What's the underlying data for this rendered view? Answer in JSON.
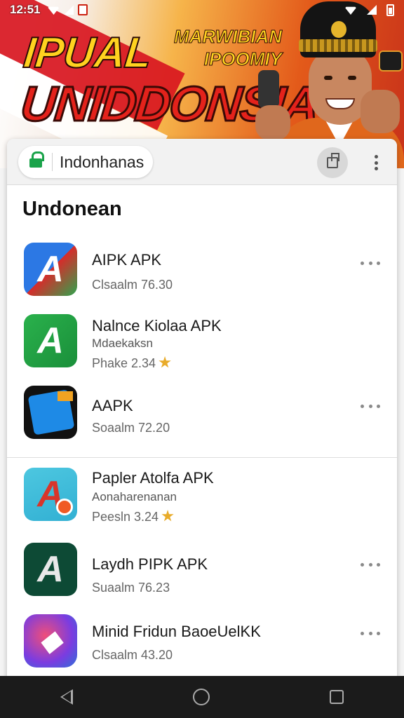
{
  "status_bar": {
    "time": "12:51"
  },
  "banner": {
    "headline_top": "IPUAL",
    "headline_small_1": "MARWIBIAN",
    "headline_small_2": "IPOOMIY",
    "headline_main": "UNIDDONSIA",
    "colors": {
      "yellow": "#ffd21f",
      "red": "#e4221b",
      "orange": "#e0671c"
    }
  },
  "browser": {
    "url_text": "Indonhanas",
    "lock_icon": "lock-icon",
    "tabs_icon": "tabs-icon",
    "menu_icon": "kebab-menu-icon"
  },
  "section_title": "Undonean",
  "apps": [
    {
      "name": "AIPK APK",
      "sub": "",
      "meta": "Clsaalm 76.30",
      "star": false,
      "more": true
    },
    {
      "name": "Nalnce Kiolaa APK",
      "sub": "Mdaekaksn",
      "meta": "Phake 2.34",
      "star": true,
      "more": false
    },
    {
      "name": "AAPK",
      "sub": "",
      "meta": "Soaalm 72.20",
      "star": false,
      "more": true
    },
    {
      "name": "Papler Atolfa APK",
      "sub": "Aonaharenanan",
      "meta": "Peesln 3.24",
      "star": true,
      "more": false
    },
    {
      "name": "Laydh PIPK APK",
      "sub": "",
      "meta": "Suaalm 76.23",
      "star": false,
      "more": true
    },
    {
      "name": "Minid Fridun BaoeUelKK",
      "sub": "",
      "meta": "Clsaalm 43.20",
      "star": false,
      "more": true
    }
  ],
  "accent_star_color": "#e8ab2a"
}
